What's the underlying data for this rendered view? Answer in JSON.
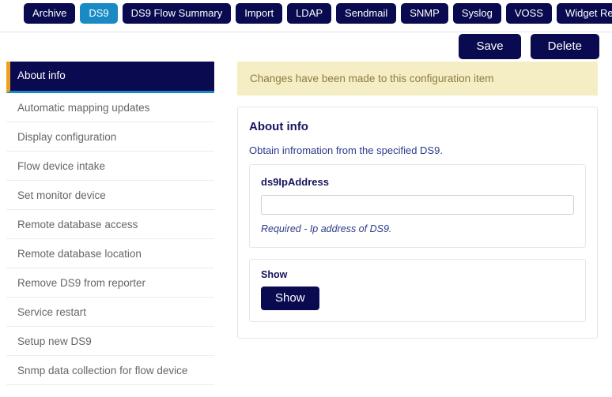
{
  "colors": {
    "navy": "#0a0a50",
    "active_tab": "#1a8ac4",
    "accent_orange": "#f0a020",
    "alert_bg": "#f5eec4",
    "alert_text": "#8a7b42",
    "heading": "#14145a",
    "body_blue": "#2b3a8a"
  },
  "tabs": [
    {
      "label": "Archive",
      "active": false
    },
    {
      "label": "DS9",
      "active": true
    },
    {
      "label": "DS9 Flow Summary",
      "active": false
    },
    {
      "label": "Import",
      "active": false
    },
    {
      "label": "LDAP",
      "active": false
    },
    {
      "label": "Sendmail",
      "active": false
    },
    {
      "label": "SNMP",
      "active": false
    },
    {
      "label": "Syslog",
      "active": false
    },
    {
      "label": "VOSS",
      "active": false
    },
    {
      "label": "Widget Resources",
      "active": false
    }
  ],
  "toolbar": {
    "save_label": "Save",
    "delete_label": "Delete"
  },
  "sidebar": {
    "items": [
      {
        "label": "About info",
        "active": true
      },
      {
        "label": "Automatic mapping updates",
        "active": false
      },
      {
        "label": "Display configuration",
        "active": false
      },
      {
        "label": "Flow device intake",
        "active": false
      },
      {
        "label": "Set monitor device",
        "active": false
      },
      {
        "label": "Remote database access",
        "active": false
      },
      {
        "label": "Remote database location",
        "active": false
      },
      {
        "label": "Remove DS9 from reporter",
        "active": false
      },
      {
        "label": "Service restart",
        "active": false
      },
      {
        "label": "Setup new DS9",
        "active": false
      },
      {
        "label": "Snmp data collection for flow device",
        "active": false
      }
    ]
  },
  "alert": {
    "message": "Changes have been made to this configuration item"
  },
  "card": {
    "title": "About info",
    "description": "Obtain infromation from the specified DS9.",
    "field": {
      "label": "ds9IpAddress",
      "value": "",
      "placeholder": "",
      "help": "Required - Ip address of DS9."
    },
    "action": {
      "label": "Show",
      "button_label": "Show"
    }
  }
}
